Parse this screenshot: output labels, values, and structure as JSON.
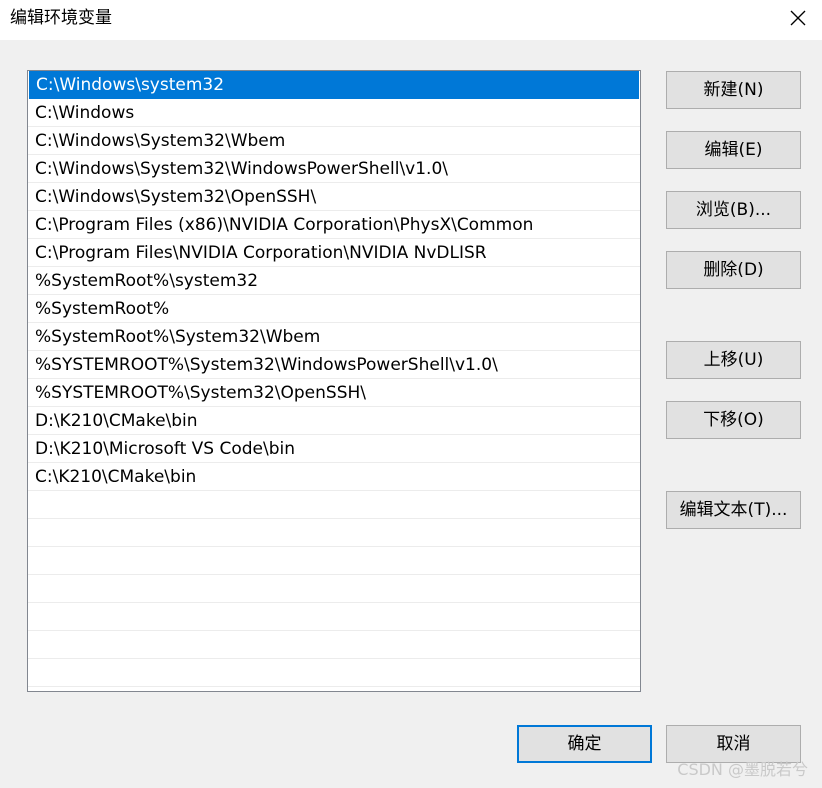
{
  "window": {
    "title": "编辑环境变量"
  },
  "list": {
    "items": [
      "C:\\Windows\\system32",
      "C:\\Windows",
      "C:\\Windows\\System32\\Wbem",
      "C:\\Windows\\System32\\WindowsPowerShell\\v1.0\\",
      "C:\\Windows\\System32\\OpenSSH\\",
      "C:\\Program Files (x86)\\NVIDIA Corporation\\PhysX\\Common",
      "C:\\Program Files\\NVIDIA Corporation\\NVIDIA NvDLISR",
      "%SystemRoot%\\system32",
      "%SystemRoot%",
      "%SystemRoot%\\System32\\Wbem",
      "%SYSTEMROOT%\\System32\\WindowsPowerShell\\v1.0\\",
      "%SYSTEMROOT%\\System32\\OpenSSH\\",
      "D:\\K210\\CMake\\bin",
      "D:\\K210\\Microsoft VS Code\\bin",
      "C:\\K210\\CMake\\bin",
      "",
      "",
      "",
      "",
      "",
      "",
      "",
      ""
    ],
    "selected_index": 0
  },
  "buttons": {
    "new": "新建(N)",
    "edit": "编辑(E)",
    "browse": "浏览(B)...",
    "delete": "删除(D)",
    "move_up": "上移(U)",
    "move_down": "下移(O)",
    "edit_text": "编辑文本(T)...",
    "ok": "确定",
    "cancel": "取消"
  },
  "watermark": "CSDN @墨脱若兮",
  "colors": {
    "selection": "#0078d7",
    "dialog_bg": "#f0f0f0"
  }
}
